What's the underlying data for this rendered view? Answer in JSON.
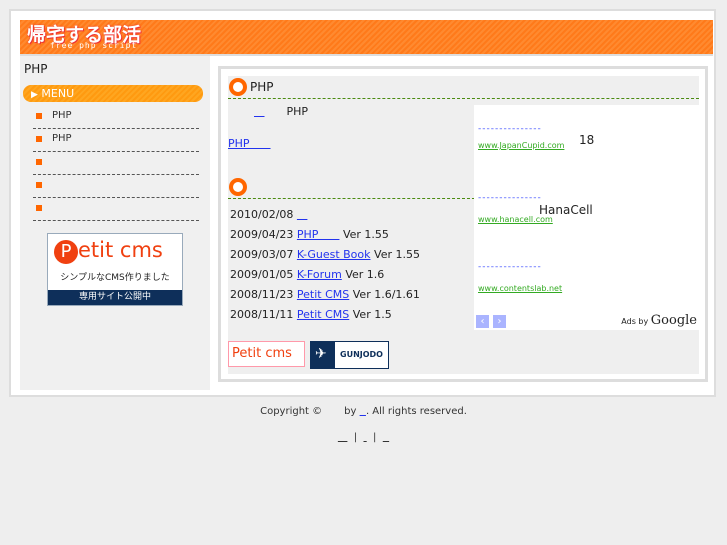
{
  "header": {
    "logo": "帰宅する部活",
    "tagline": "free php script"
  },
  "sidebar": {
    "title": "PHP",
    "menu_label": "MENU",
    "items": [
      {
        "label": "PHP"
      },
      {
        "label": "PHP"
      },
      {
        "label": ""
      },
      {
        "label": ""
      },
      {
        "label": ""
      }
    ],
    "banner": {
      "brand": "etit cms",
      "brand_initial": "P",
      "slogan": "シンプルなCMS作りました",
      "bar": "専用サイト公開中"
    }
  },
  "main": {
    "section1": {
      "title": "PHP",
      "intro_link": "   ",
      "intro_text": "PHP",
      "link": "PHP      "
    },
    "section2": {
      "title": "",
      "news": [
        {
          "date": "2010/02/08",
          "link": "   ",
          "suffix": ""
        },
        {
          "date": "2009/04/23",
          "link": "PHP      ",
          "suffix": "Ver 1.55"
        },
        {
          "date": "2009/03/07",
          "link": "K-Guest Book",
          "suffix": "Ver 1.55"
        },
        {
          "date": "2009/01/05",
          "link": "K-Forum",
          "suffix": "Ver 1.6"
        },
        {
          "date": "2008/11/23",
          "link": "Petit CMS",
          "suffix": "Ver 1.6/1.61"
        },
        {
          "date": "2008/11/11",
          "link": "Petit CMS",
          "suffix": "Ver 1.5"
        }
      ]
    },
    "ads": [
      {
        "title": "---------------",
        "text": "18",
        "url": "www.JapanCupid.com"
      },
      {
        "title": "---------------",
        "text": "HanaCell",
        "url": "www.hanacell.com"
      },
      {
        "title": "---------------",
        "text": "",
        "url": "www.contentslab.net"
      }
    ],
    "ads_by": "Ads by",
    "google": "Google",
    "footer_banners": {
      "petit": "Petit cms",
      "gunjodo": "GUNJODO"
    }
  },
  "footer": {
    "copyright": "Copyright ©",
    "by": "by",
    "owner_link": "  ",
    "rights": ". All rights reserved.",
    "links": [
      "   ",
      " ",
      "  "
    ]
  },
  "colors": {
    "accent": "#ff6600",
    "link": "#2233ee",
    "ad_url": "#33aa22"
  }
}
